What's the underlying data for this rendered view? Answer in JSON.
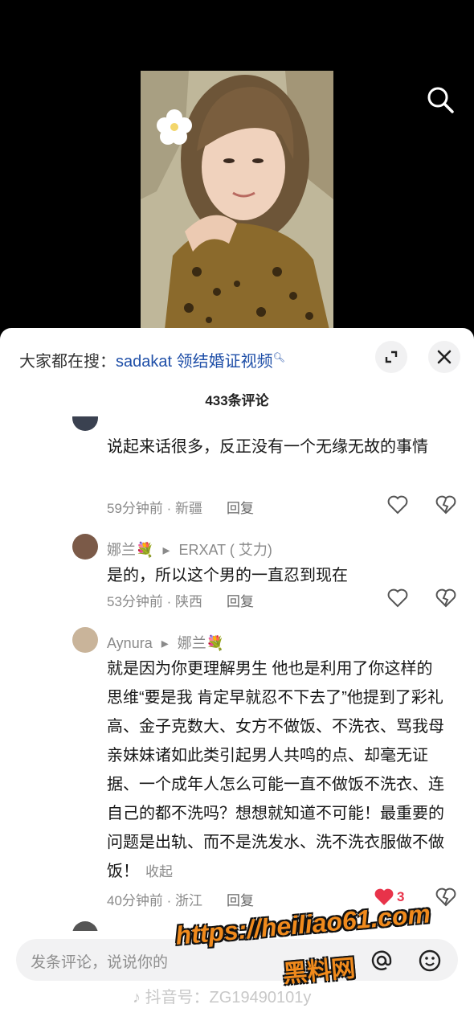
{
  "header": {
    "hot_prefix": "大家都在搜：",
    "hot_keyword": "sadakat 领结婚证视频",
    "hot_icon": "search-icon"
  },
  "comments_count": "433条评论",
  "comments": [
    {
      "text": "说起来话很多，反正没有一个无缘无故的事情",
      "meta": "59分钟前 · 新疆",
      "reply": "回复"
    },
    {
      "name": "娜兰💐",
      "reply_to": "ERXAT ( 艾力)",
      "text": "是的，所以这个男的一直忍到现在",
      "meta": "53分钟前 · 陕西",
      "reply": "回复"
    },
    {
      "name": "Aynura",
      "reply_to": "娜兰💐",
      "text": "就是因为你更理解男生 他也是利用了你这样的思维“要是我 肯定早就忍不下去了”他提到了彩礼高、金子克数大、女方不做饭、不洗衣、骂我母亲妹妹诸如此类引起男人共鸣的点、却毫无证据、一个成年人怎么可能一直不做饭不洗衣、连自己的都不洗吗？想想就知道不可能！最重要的问题是出轨、而不是洗发水、洗不洗衣服做不做饭！",
      "fold": "收起",
      "meta": "40分钟前 · 浙江",
      "reply": "回复",
      "likes": "3"
    }
  ],
  "input": {
    "placeholder": "发条评论，说说你的"
  },
  "watermark": {
    "line1": "https://heiliao61.com",
    "line2": "黑料网"
  },
  "douyin_id": "抖音号：ZG19490101y",
  "colors": {
    "accent_blue": "#1f4fa8",
    "like_red": "#e8334a",
    "watermark": "#f08a1c"
  }
}
